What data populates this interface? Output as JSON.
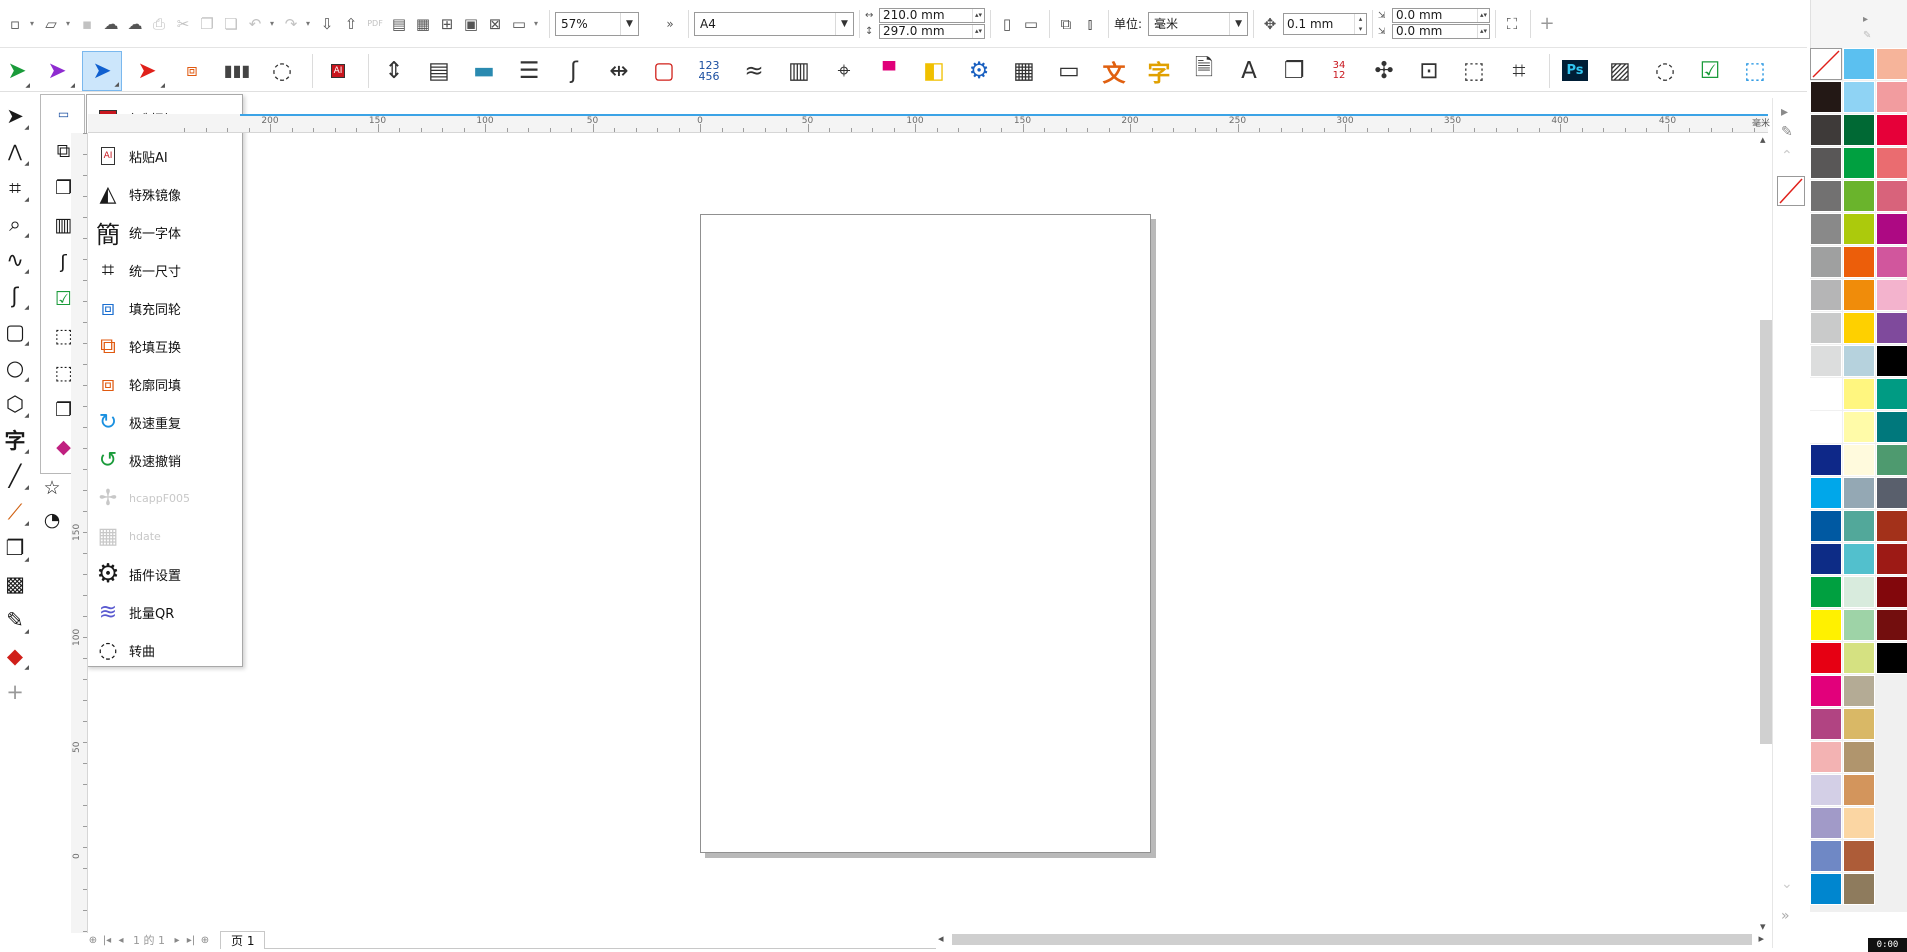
{
  "toolbar1": {
    "zoom": "57%",
    "page_size": "A4",
    "width": "210.0 mm",
    "height": "297.0 mm",
    "unit_label": "单位:",
    "unit_value": "毫米",
    "nudge": "0.1 mm",
    "dup_x": "0.0 mm",
    "dup_y": "0.0 mm",
    "pdf_label": "PDF"
  },
  "menu": {
    "items": [
      {
        "label": "复制到AI",
        "enabled": true
      },
      {
        "label": "粘贴AI",
        "enabled": true
      },
      {
        "label": "特殊镜像",
        "enabled": true
      },
      {
        "label": "统一字体",
        "enabled": true
      },
      {
        "label": "统一尺寸",
        "enabled": true
      },
      {
        "label": "填充同轮",
        "enabled": true
      },
      {
        "label": "轮填互换",
        "enabled": true
      },
      {
        "label": "轮廓同填",
        "enabled": true
      },
      {
        "label": "极速重复",
        "enabled": true
      },
      {
        "label": "极速撤销",
        "enabled": true
      },
      {
        "label": "hcappF005",
        "enabled": false
      },
      {
        "label": "hdate",
        "enabled": false
      },
      {
        "label": "插件设置",
        "enabled": true
      },
      {
        "label": "批量QR",
        "enabled": true
      },
      {
        "label": "转曲",
        "enabled": true
      }
    ]
  },
  "toolbar2_glyphs": {
    "ai": "AI",
    "num": "123\n456",
    "wen": "文",
    "zi": "字",
    "ps": "Ps",
    "num34": "34\n12"
  },
  "ruler": {
    "h_labels": [
      "200",
      "150",
      "100",
      "50",
      "0",
      "50",
      "100",
      "150",
      "200",
      "250",
      "300",
      "350",
      "400",
      "450"
    ],
    "v_labels": [
      "150",
      "100",
      "50",
      "0"
    ],
    "unit": "毫米"
  },
  "pagebar": {
    "page_counter": "1 的 1",
    "page_tab": "页 1"
  },
  "toolbox_glyphs": {
    "text_tool": "字"
  },
  "clock": "0:00",
  "palette_colors": [
    [
      "none",
      "#5bc0f0",
      "#f6b49a"
    ],
    [
      "#231815",
      "#8fd3f4",
      "#f29c9f"
    ],
    [
      "#3e3a39",
      "#006934",
      "#e60039"
    ],
    [
      "#595757",
      "#00a040",
      "#ea6c70"
    ],
    [
      "#727171",
      "#6ab42c",
      "#d8637b"
    ],
    [
      "#898989",
      "#acca0c",
      "#ad0983"
    ],
    [
      "#9fa0a0",
      "#ec5e0a",
      "#d1569d"
    ],
    [
      "#b5b5b6",
      "#f08c0a",
      "#f3b3cd"
    ],
    [
      "#c9caca",
      "#fed000",
      "#7f4a9c"
    ],
    [
      "#dcdddd",
      "#b6d2dd",
      "#000000"
    ],
    [
      "#ffffff",
      "#fff67f",
      "#009b83"
    ],
    [
      "#ffffff",
      "#fffba8",
      "#00787c"
    ],
    [
      "#0e2888",
      "#fffadd",
      "#4e9a6f"
    ],
    [
      "#00a7ea",
      "#94a8b4",
      "#595f6c"
    ],
    [
      "#0059a2",
      "#52a89a",
      "#a3311a"
    ],
    [
      "#0d2c86",
      "#52c0cd",
      "#9d1a15"
    ],
    [
      "#00a040",
      "#d8ebdd",
      "#82070c"
    ],
    [
      "#fff100",
      "#9ed3a7",
      "#730e0e"
    ],
    [
      "#e60013",
      "#d5e181",
      "#000000"
    ],
    [
      "#e2007b",
      "#b4ab95",
      null
    ],
    [
      "#b14482",
      "#d9b866",
      null
    ],
    [
      "#f3b3b3",
      "#b0956d",
      null
    ],
    [
      "#d3cfe6",
      "#d3955c",
      null
    ],
    [
      "#a19ac8",
      "#fbd6a3",
      null
    ],
    [
      "#6f88c5",
      "#ad5c38",
      null
    ],
    [
      "#0086cf",
      "#8e7b5d",
      null
    ]
  ]
}
